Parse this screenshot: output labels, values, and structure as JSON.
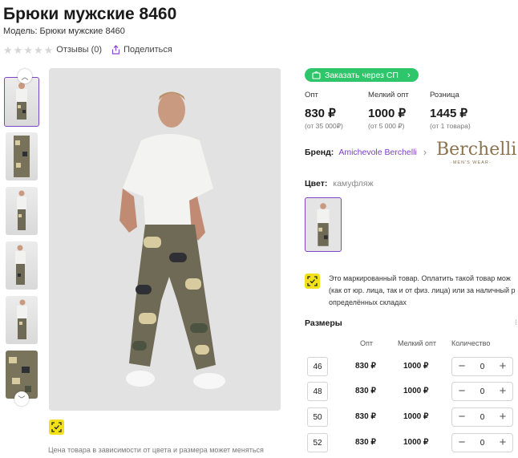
{
  "product": {
    "title": "Брюки мужские 8460",
    "model_label": "Модель:",
    "model_value": "Брюки мужские 8460",
    "reviews": "Отзывы (0)",
    "share": "Поделиться"
  },
  "order_button": "Заказать через СП",
  "prices": [
    {
      "label": "Опт",
      "value": "830 ₽",
      "note": "(от 35 000₽)"
    },
    {
      "label": "Мелкий опт",
      "value": "1000 ₽",
      "note": "(от 5 000 ₽)"
    },
    {
      "label": "Розница",
      "value": "1445 ₽",
      "note": "(от 1 товара)"
    }
  ],
  "brand": {
    "label": "Бренд:",
    "name": "Amichevole Berchelli",
    "logo_text": "Berchelli",
    "logo_sub": "·MEN'S WEAR·"
  },
  "color": {
    "label": "Цвет:",
    "value": "камуфляж"
  },
  "marked": {
    "lines": [
      "Это маркированный товар. Оплатить такой товар мож",
      "(как от юр. лица, так и от физ. лица) или за наличный р",
      "определённых складах"
    ]
  },
  "sizes": {
    "title": "Размеры",
    "headers": {
      "opt": "Опт",
      "small": "Мелкий опт",
      "qty": "Количество"
    },
    "rows": [
      {
        "size": "46",
        "opt": "830 ₽",
        "small": "1000 ₽",
        "qty": "0"
      },
      {
        "size": "48",
        "opt": "830 ₽",
        "small": "1000 ₽",
        "qty": "0"
      },
      {
        "size": "50",
        "opt": "830 ₽",
        "small": "1000 ₽",
        "qty": "0"
      },
      {
        "size": "52",
        "opt": "830 ₽",
        "small": "1000 ₽",
        "qty": "0"
      }
    ]
  },
  "price_note": "Цена товара в зависимости от цвета и размера может меняться",
  "colors": {
    "accent": "#7b45c6",
    "green": "#2fc56a",
    "mark": "#f2e11a"
  }
}
